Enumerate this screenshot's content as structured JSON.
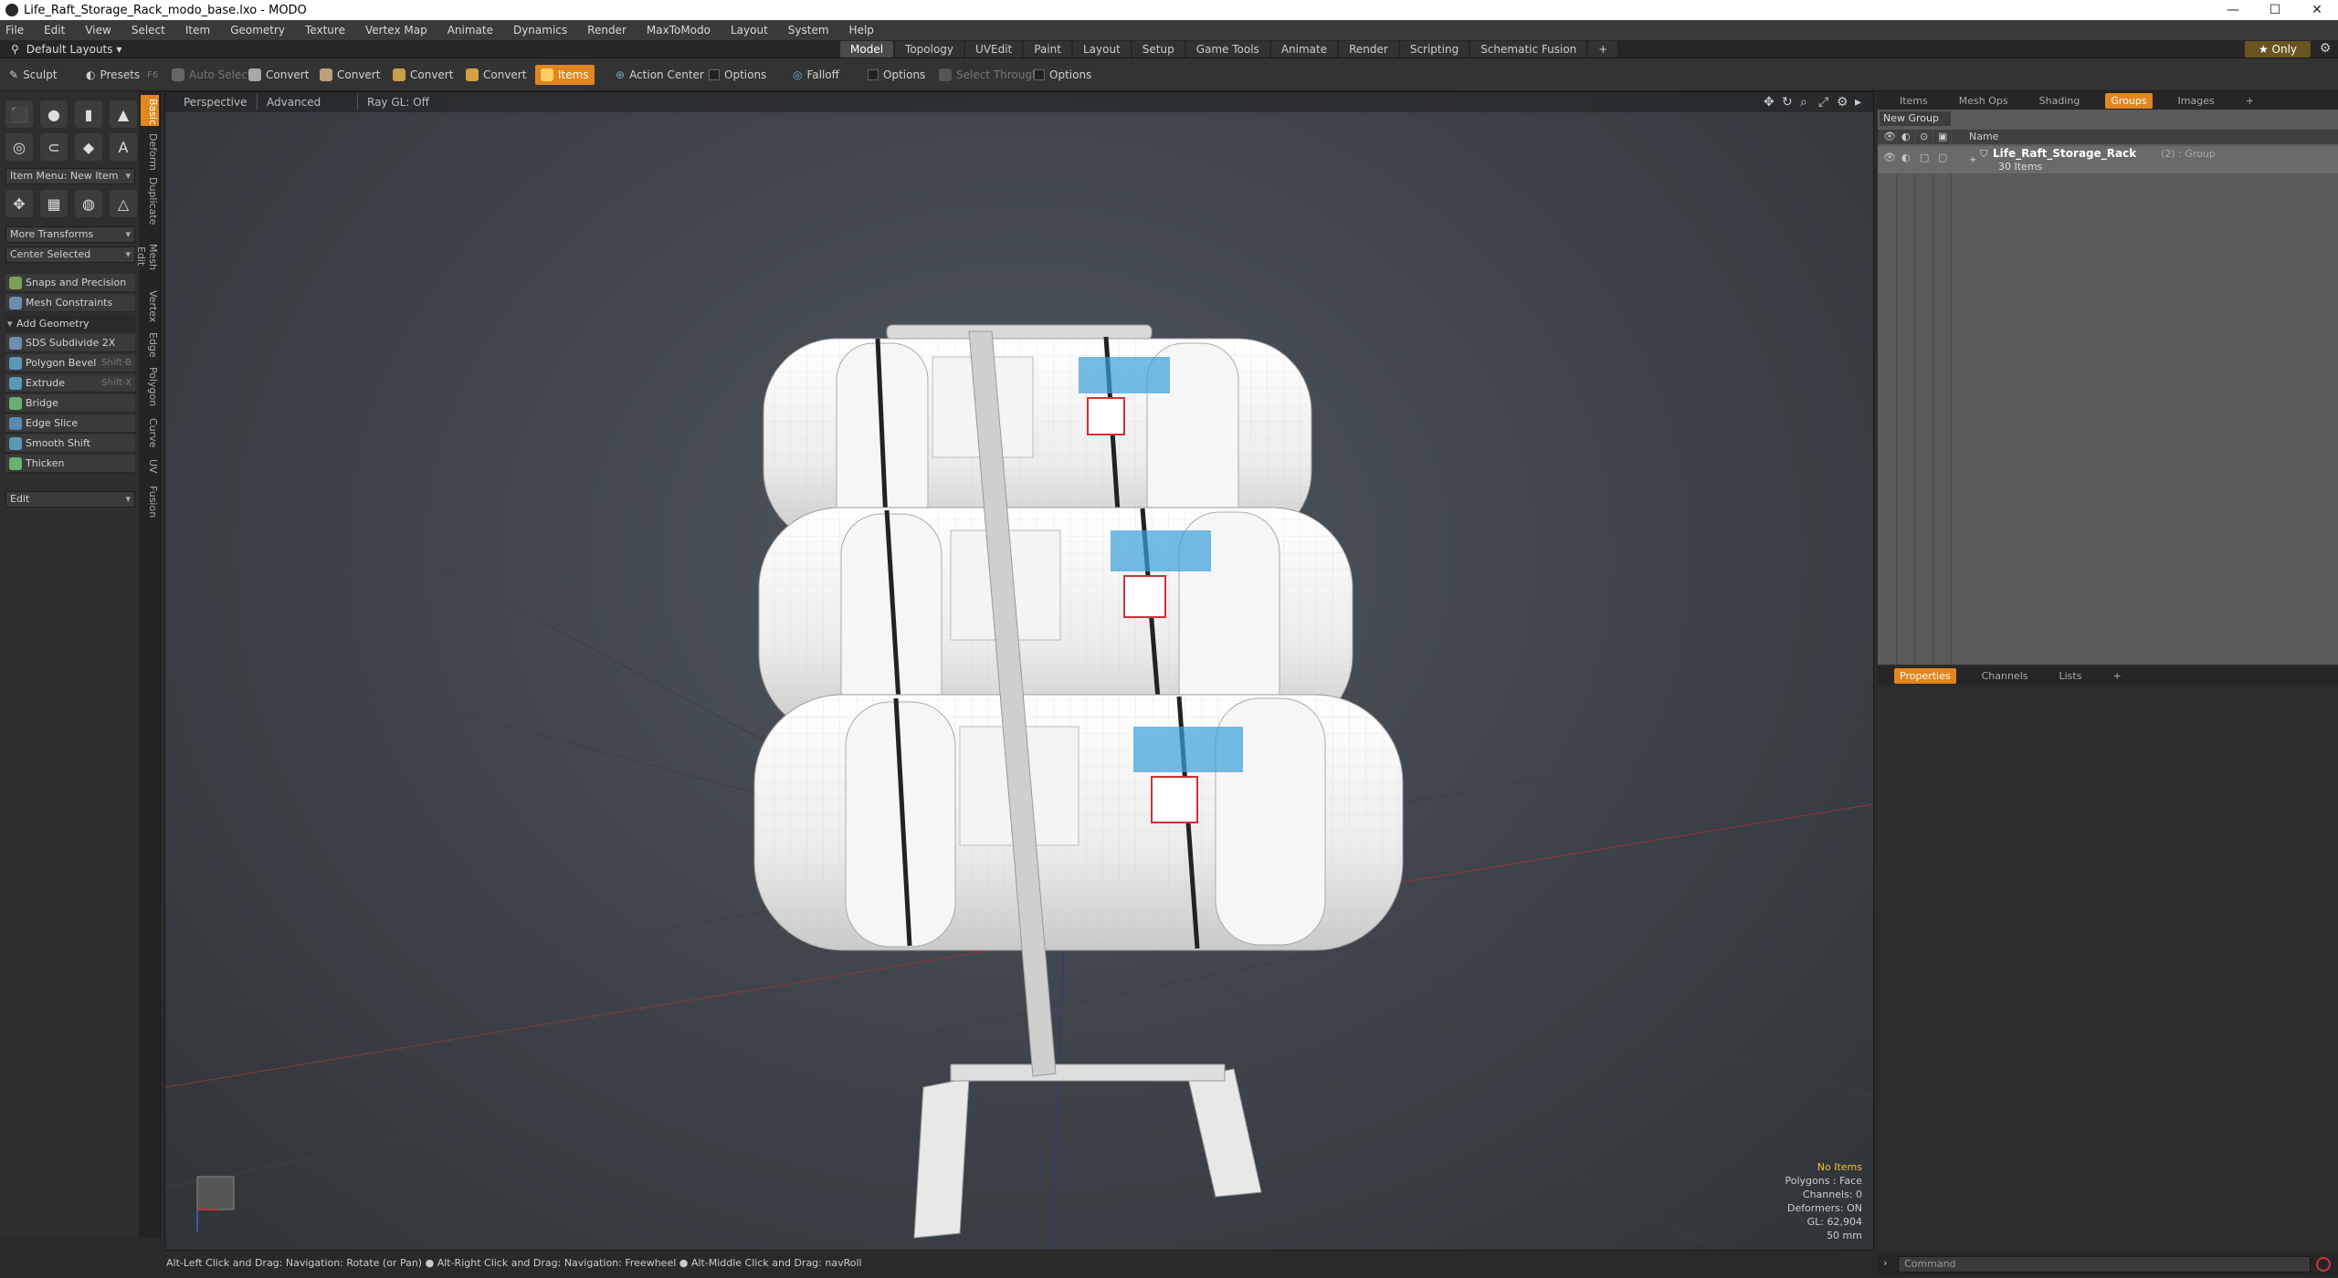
{
  "window": {
    "title": "Life_Raft_Storage_Rack_modo_base.lxo - MODO"
  },
  "menu": [
    "File",
    "Edit",
    "View",
    "Select",
    "Item",
    "Geometry",
    "Texture",
    "Vertex Map",
    "Animate",
    "Dynamics",
    "Render",
    "MaxToModo",
    "Layout",
    "System",
    "Help"
  ],
  "layouts": {
    "dropdown": "Default Layouts ▾",
    "tabs": [
      "Model",
      "Topology",
      "UVEdit",
      "Paint",
      "Layout",
      "Setup",
      "Game Tools",
      "Animate",
      "Render",
      "Scripting",
      "Schematic Fusion",
      "+"
    ],
    "active": "Model",
    "only": "★ Only"
  },
  "toolbar": {
    "sculpt": "Sculpt",
    "presets": "Presets",
    "presets_sc": "F6",
    "auto_select": "Auto Select",
    "convert": "Convert",
    "items": "Items",
    "action_center": "Action Center",
    "options": "Options",
    "falloff": "Falloff",
    "select_through": "Select Through"
  },
  "left": {
    "item_menu": "Item Menu: New Item",
    "more_transforms": "More Transforms",
    "center_selected": "Center Selected",
    "snaps": "Snaps and Precision",
    "mesh_constraints": "Mesh Constraints",
    "add_geometry": "Add Geometry",
    "tools": [
      {
        "label": "SDS Subdivide 2X",
        "sc": ""
      },
      {
        "label": "Polygon Bevel",
        "sc": "Shift-B"
      },
      {
        "label": "Extrude",
        "sc": "Shift-X"
      },
      {
        "label": "Bridge",
        "sc": ""
      },
      {
        "label": "Edge Slice",
        "sc": ""
      },
      {
        "label": "Smooth Shift",
        "sc": ""
      },
      {
        "label": "Thicken",
        "sc": ""
      }
    ],
    "edit": "Edit",
    "vtabs": [
      "Basic",
      "Deform",
      "Duplicate",
      "Mesh Edit",
      "Vertex",
      "Edge",
      "Polygon",
      "Curve",
      "UV",
      "Fusion"
    ]
  },
  "viewport": {
    "tabs": [
      "Perspective",
      "Advanced",
      "Ray GL: Off"
    ],
    "info": {
      "no_items": "No Items",
      "polygons": "Polygons : Face",
      "channels": "Channels: 0",
      "deformers": "Deformers: ON",
      "gl": "GL: 62,904",
      "mm": "50 mm"
    },
    "status": "Alt-Left Click and Drag: Navigation: Rotate (or Pan) ● Alt-Right Click and Drag: Navigation: Freewheel ● Alt-Middle Click and Drag: navRoll"
  },
  "right": {
    "tabs_top": [
      "Items",
      "Mesh Ops",
      "Shading",
      "Groups",
      "Images",
      "+"
    ],
    "active_top": "Groups",
    "new_group": "New Group",
    "name_header": "Name",
    "group_name": "Life_Raft_Storage_Rack",
    "group_meta": "(2) : Group",
    "group_items": "30 Items",
    "tabs_bottom": [
      "Properties",
      "Channels",
      "Lists",
      "+"
    ],
    "active_bottom": "Properties"
  },
  "command": {
    "placeholder": "Command"
  }
}
